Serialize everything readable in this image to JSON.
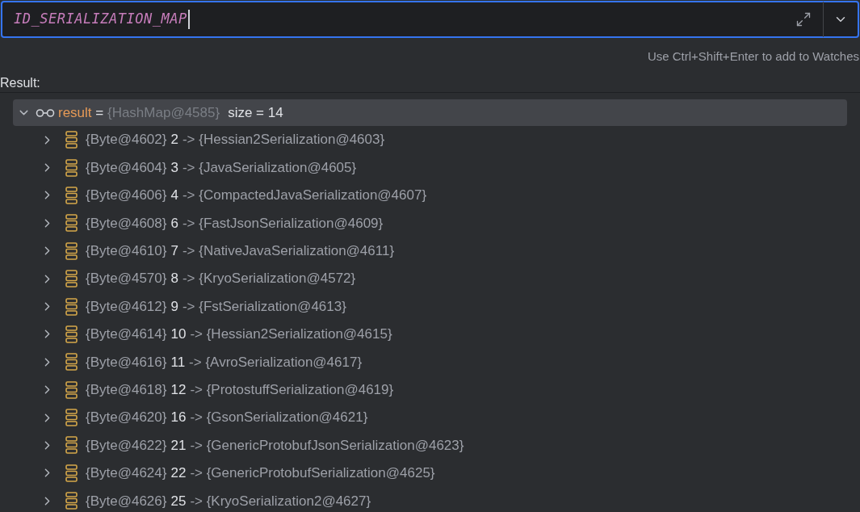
{
  "expression_field": {
    "value": "ID_SERIALIZATION_MAP"
  },
  "hint": "Use Ctrl+Shift+Enter to add to Watches",
  "result_label": "Result:",
  "result": {
    "name": "result",
    "equals": " = ",
    "ref": "{HashMap@4585}",
    "info": "size = 14",
    "expanded": true,
    "selected": true,
    "children": [
      {
        "ref": "{Byte@4602}",
        "key": "2",
        "value": "-> {Hessian2Serialization@4603}",
        "expanded": false
      },
      {
        "ref": "{Byte@4604}",
        "key": "3",
        "value": "-> {JavaSerialization@4605}",
        "expanded": false
      },
      {
        "ref": "{Byte@4606}",
        "key": "4",
        "value": "-> {CompactedJavaSerialization@4607}",
        "expanded": false
      },
      {
        "ref": "{Byte@4608}",
        "key": "6",
        "value": "-> {FastJsonSerialization@4609}",
        "expanded": false
      },
      {
        "ref": "{Byte@4610}",
        "key": "7",
        "value": "-> {NativeJavaSerialization@4611}",
        "expanded": false
      },
      {
        "ref": "{Byte@4570}",
        "key": "8",
        "value": "-> {KryoSerialization@4572}",
        "expanded": false
      },
      {
        "ref": "{Byte@4612}",
        "key": "9",
        "value": "-> {FstSerialization@4613}",
        "expanded": false
      },
      {
        "ref": "{Byte@4614}",
        "key": "10",
        "value": "-> {Hessian2Serialization@4615}",
        "expanded": false
      },
      {
        "ref": "{Byte@4616}",
        "key": "11",
        "value": "-> {AvroSerialization@4617}",
        "expanded": false
      },
      {
        "ref": "{Byte@4618}",
        "key": "12",
        "value": "-> {ProtostuffSerialization@4619}",
        "expanded": false
      },
      {
        "ref": "{Byte@4620}",
        "key": "16",
        "value": "-> {GsonSerialization@4621}",
        "expanded": false
      },
      {
        "ref": "{Byte@4622}",
        "key": "21",
        "value": "-> {GenericProtobufJsonSerialization@4623}",
        "expanded": false
      },
      {
        "ref": "{Byte@4624}",
        "key": "22",
        "value": "-> {GenericProtobufSerialization@4625}",
        "expanded": false
      },
      {
        "ref": "{Byte@4626}",
        "key": "25",
        "value": "-> {KryoSerialization2@4627}",
        "expanded": false
      }
    ]
  }
}
